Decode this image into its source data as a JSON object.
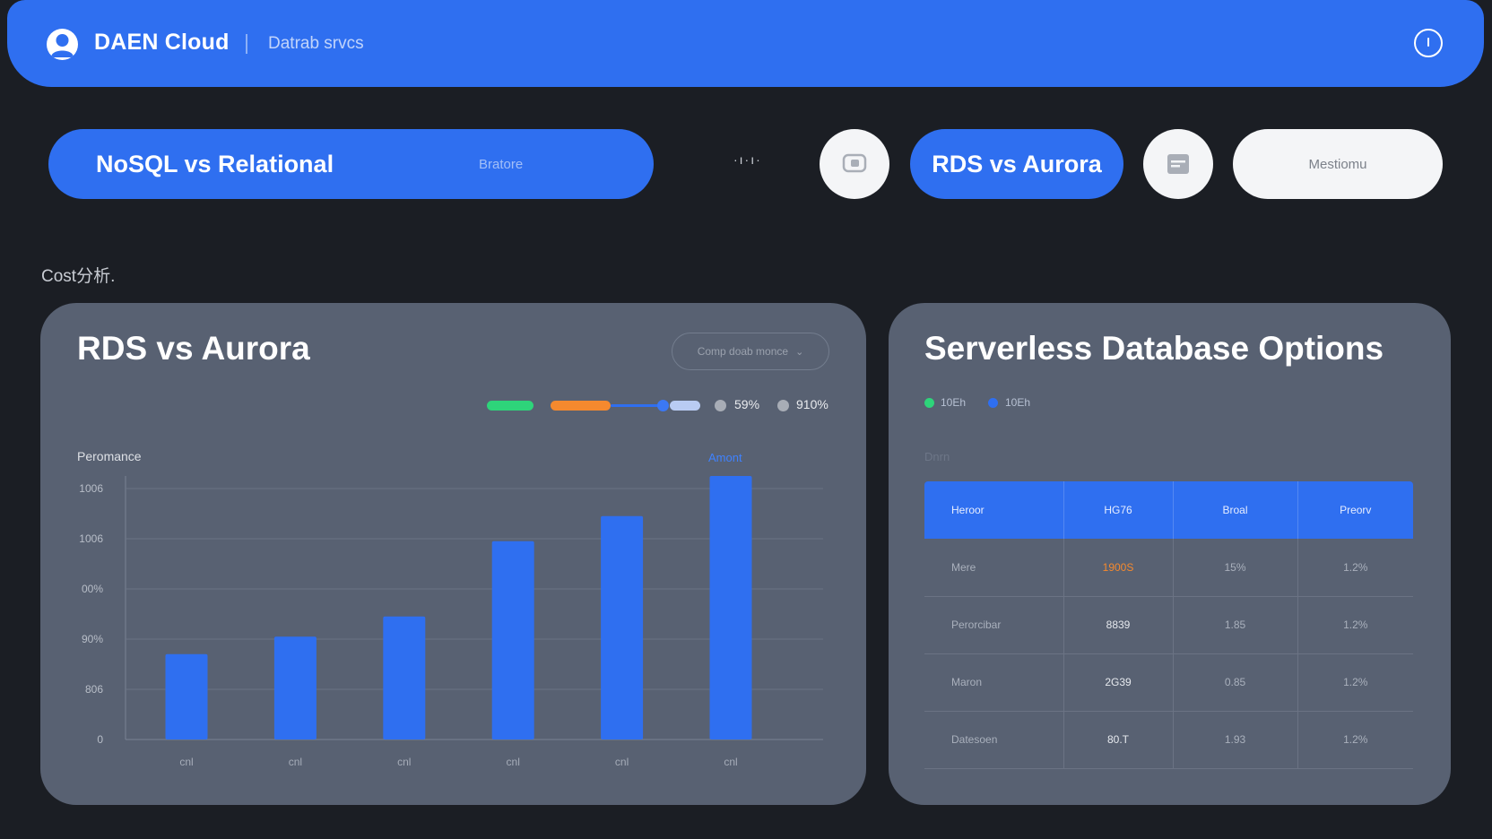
{
  "header": {
    "brand": "DAEN Cloud",
    "subtitle": "Datrab srvcs",
    "right_icon": "clock-icon",
    "logo_icon": "user-avatar-icon"
  },
  "pills": {
    "nosql_label": "NoSQL vs Relational",
    "nosql_sub": "Bratore",
    "loader_text": "·ı·ı·",
    "rds_label": "RDS vs Aurora",
    "white_label": "Mestiomu",
    "icon_1": "chat-icon",
    "icon_2": "document-icon"
  },
  "section_label": "Cost分析.",
  "left_card": {
    "title": "RDS vs Aurora",
    "dropdown_label": "Comp doab monce",
    "legend_pct_1": "59%",
    "legend_pct_2": "910%",
    "y_label": "Peromance",
    "annotation": "Amont"
  },
  "chart_data": {
    "type": "bar",
    "categories": [
      "cnl",
      "cnl",
      "cnl",
      "cnl",
      "cnl",
      "cnl"
    ],
    "values": [
      17,
      20.5,
      24.5,
      39.5,
      44.5,
      52.5
    ],
    "ytick_labels": [
      "0",
      "806",
      "90%",
      "00%",
      "1006",
      "1006"
    ],
    "ytick_values": [
      0,
      10,
      20,
      30,
      40,
      50
    ],
    "ylim": [
      0,
      52.5
    ],
    "grid": true,
    "bar_color": "#2f6ff0"
  },
  "right_card": {
    "title": "Serverless Database Options",
    "legend": [
      {
        "label": "10Eh",
        "color": "#2ed47a"
      },
      {
        "label": "10Eh",
        "color": "#2f6ff0"
      }
    ],
    "sub_label": "Dnrn",
    "table": {
      "headers": [
        "Heroor",
        "HG76",
        "Broal",
        "Preorv"
      ],
      "rows": [
        [
          "Mere",
          "1900S",
          "15%",
          "1.2%"
        ],
        [
          "Perorcibar",
          "8839",
          "1.85",
          "1.2%"
        ],
        [
          "Maron",
          "2G39",
          "0.85",
          "1.2%"
        ],
        [
          "Datesoen",
          "80.T",
          "1.93",
          "1.2%"
        ]
      ]
    }
  },
  "colors": {
    "accent": "#2f6ff0",
    "background": "#1b1e24",
    "card": "#586172",
    "green": "#2ed47a",
    "orange": "#f5892e"
  }
}
